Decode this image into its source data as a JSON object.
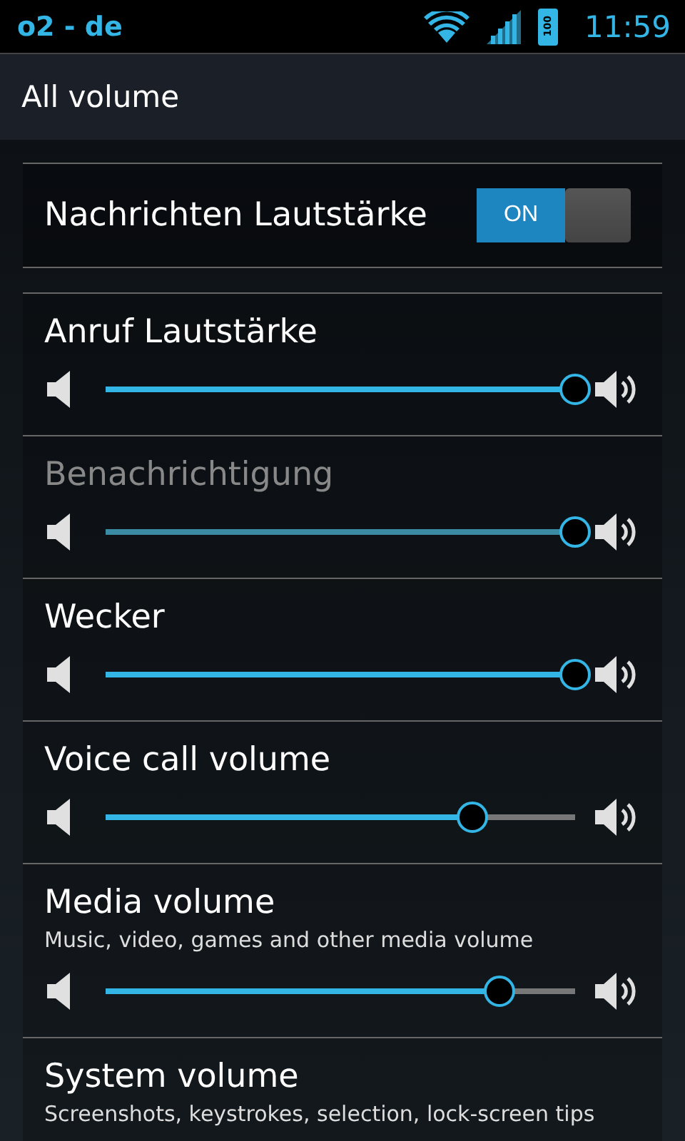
{
  "status_bar": {
    "carrier": "o2 - de",
    "battery_text": "100",
    "time": "11:59"
  },
  "header": {
    "title": "All volume"
  },
  "settings": [
    {
      "kind": "toggle",
      "title": "Nachrichten Lautstärke",
      "on": true,
      "on_label": "ON"
    },
    {
      "kind": "slider",
      "title": "Anruf Lautstärke",
      "disabled": false,
      "level": 1.0
    },
    {
      "kind": "slider",
      "title": "Benachrichtigung",
      "disabled": true,
      "level": 1.0
    },
    {
      "kind": "slider",
      "title": "Wecker",
      "disabled": false,
      "level": 1.0
    },
    {
      "kind": "slider",
      "title": "Voice call volume",
      "disabled": false,
      "level": 0.78
    },
    {
      "kind": "slider",
      "title": "Media volume",
      "subtitle": "Music, video, games and other media volume",
      "disabled": false,
      "level": 0.84
    },
    {
      "kind": "slider",
      "title": "System volume",
      "subtitle": "Screenshots, keystrokes, selection, lock-screen tips",
      "disabled": false
    }
  ]
}
